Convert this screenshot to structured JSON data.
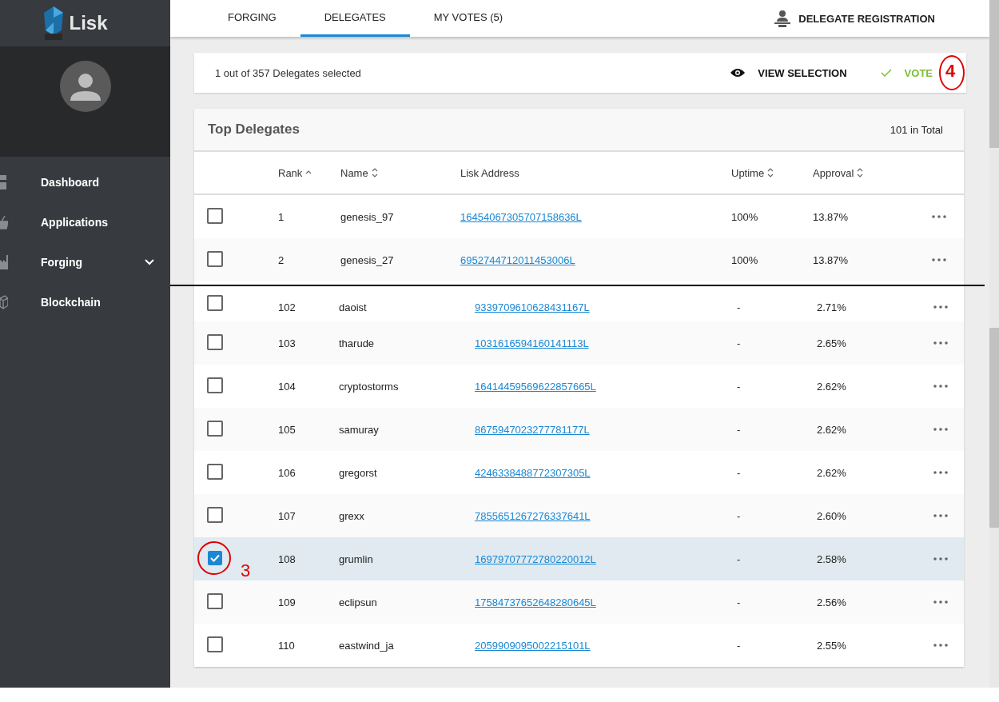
{
  "sidebar": {
    "logo": "Lisk",
    "items": [
      {
        "label": "Dashboard",
        "kind": "link"
      },
      {
        "label": "Applications",
        "kind": "link"
      },
      {
        "label": "Forging",
        "kind": "expandable"
      },
      {
        "label": "Blockchain",
        "kind": "link"
      }
    ]
  },
  "tabs": [
    {
      "label": "FORGING",
      "selected": false
    },
    {
      "label": "DELEGATES",
      "selected": true
    },
    {
      "label": "MY VOTES (5)",
      "selected": false
    }
  ],
  "header_action": "DELEGATE REGISTRATION",
  "selection_bar": {
    "summary": "1 out of 357 Delegates selected",
    "actions": [
      {
        "label": "VIEW SELECTION",
        "kind": "view"
      },
      {
        "label": "VOTE",
        "kind": "vote",
        "annotation": "4"
      }
    ]
  },
  "table": {
    "title": "Top Delegates",
    "total": "101 in Total",
    "columns": [
      {
        "label": "Rank",
        "kind": "sortable",
        "sorted": true
      },
      {
        "label": "Name",
        "kind": "sortable",
        "sorted": false
      },
      {
        "label": "Lisk Address",
        "kind": "plain"
      },
      {
        "label": "Uptime",
        "kind": "sortable",
        "sorted": false
      },
      {
        "label": "Approval",
        "kind": "sortable",
        "sorted": false
      }
    ],
    "top_rows": [
      {
        "rank": "1",
        "name": "genesis_97",
        "address": "16454067305707158636L",
        "uptime": "100%",
        "approval": "13.87%",
        "selected": false
      },
      {
        "rank": "2",
        "name": "genesis_27",
        "address": "6952744712011453006L",
        "uptime": "100%",
        "approval": "13.87%",
        "selected": false
      }
    ],
    "bottom_rows": [
      {
        "rank": "102",
        "name": "daoist",
        "address": "9339709610628431167L",
        "uptime": "-",
        "approval": "2.71%",
        "selected": false
      },
      {
        "rank": "103",
        "name": "tharude",
        "address": "1031616594160141113L",
        "uptime": "-",
        "approval": "2.65%",
        "selected": false
      },
      {
        "rank": "104",
        "name": "cryptostorms",
        "address": "16414459569622857665L",
        "uptime": "-",
        "approval": "2.62%",
        "selected": false
      },
      {
        "rank": "105",
        "name": "samuray",
        "address": "8675947023277781177L",
        "uptime": "-",
        "approval": "2.62%",
        "selected": false
      },
      {
        "rank": "106",
        "name": "gregorst",
        "address": "4246338488772307305L",
        "uptime": "-",
        "approval": "2.62%",
        "selected": false
      },
      {
        "rank": "107",
        "name": "grexx",
        "address": "7855651267276337641L",
        "uptime": "-",
        "approval": "2.60%",
        "selected": false
      },
      {
        "rank": "108",
        "name": "grumlin",
        "address": "16979707772780220012L",
        "uptime": "-",
        "approval": "2.58%",
        "selected": true,
        "annotation": "3"
      },
      {
        "rank": "109",
        "name": "eclipsun",
        "address": "17584737652648280645L",
        "uptime": "-",
        "approval": "2.56%",
        "selected": false
      },
      {
        "rank": "110",
        "name": "eastwind_ja",
        "address": "2059909095002215101L",
        "uptime": "-",
        "approval": "2.55%",
        "selected": false
      }
    ]
  }
}
